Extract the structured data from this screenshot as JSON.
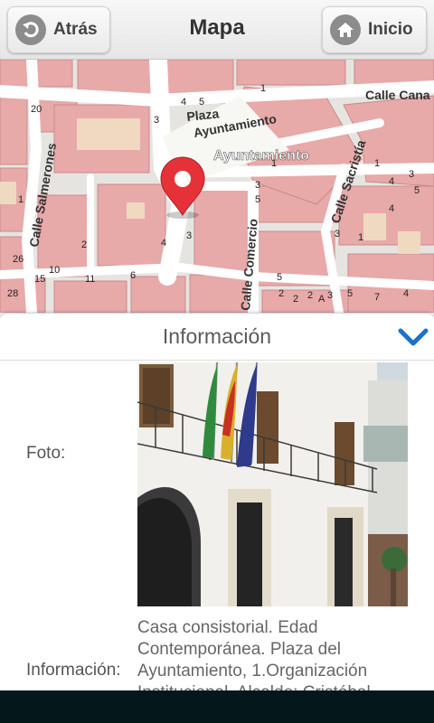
{
  "header": {
    "title": "Mapa",
    "back_label": "Atrás",
    "home_label": "Inicio"
  },
  "map": {
    "labels": {
      "plaza": "Plaza",
      "ayuntamiento_street": "Ayuntamiento",
      "poi": "Ayuntamiento",
      "calle_cana": "Calle Cana",
      "calle_salmerones": "Calle Salmerones",
      "calle_sacristia": "Calle Sacristía",
      "calle_comercio": "Calle Comercio"
    },
    "numbers": [
      "20",
      "4",
      "5",
      "1",
      "3",
      "1",
      "3",
      "5",
      "1",
      "4",
      "3",
      "5",
      "3",
      "1",
      "26",
      "1",
      "2",
      "15",
      "10",
      "11",
      "6",
      "4",
      "3",
      "5",
      "4",
      "28",
      "2",
      "2",
      "2",
      "A",
      "3",
      "5",
      "7",
      "4"
    ],
    "colors": {
      "building": "#e8a9a9",
      "building_alt": "#efd9c1",
      "street": "#ffffff",
      "background": "#e6e4e0",
      "marker": "#e53238"
    }
  },
  "info_panel": {
    "title": "Información",
    "photo_label": "Foto:",
    "info_label": "Información:",
    "info_text": "Casa consistorial. Edad Contemporánea. Plaza del Ayuntamiento, 1.Organización Institucional. Alcalde: Cristóbal",
    "accent_color": "#1a73c8"
  }
}
